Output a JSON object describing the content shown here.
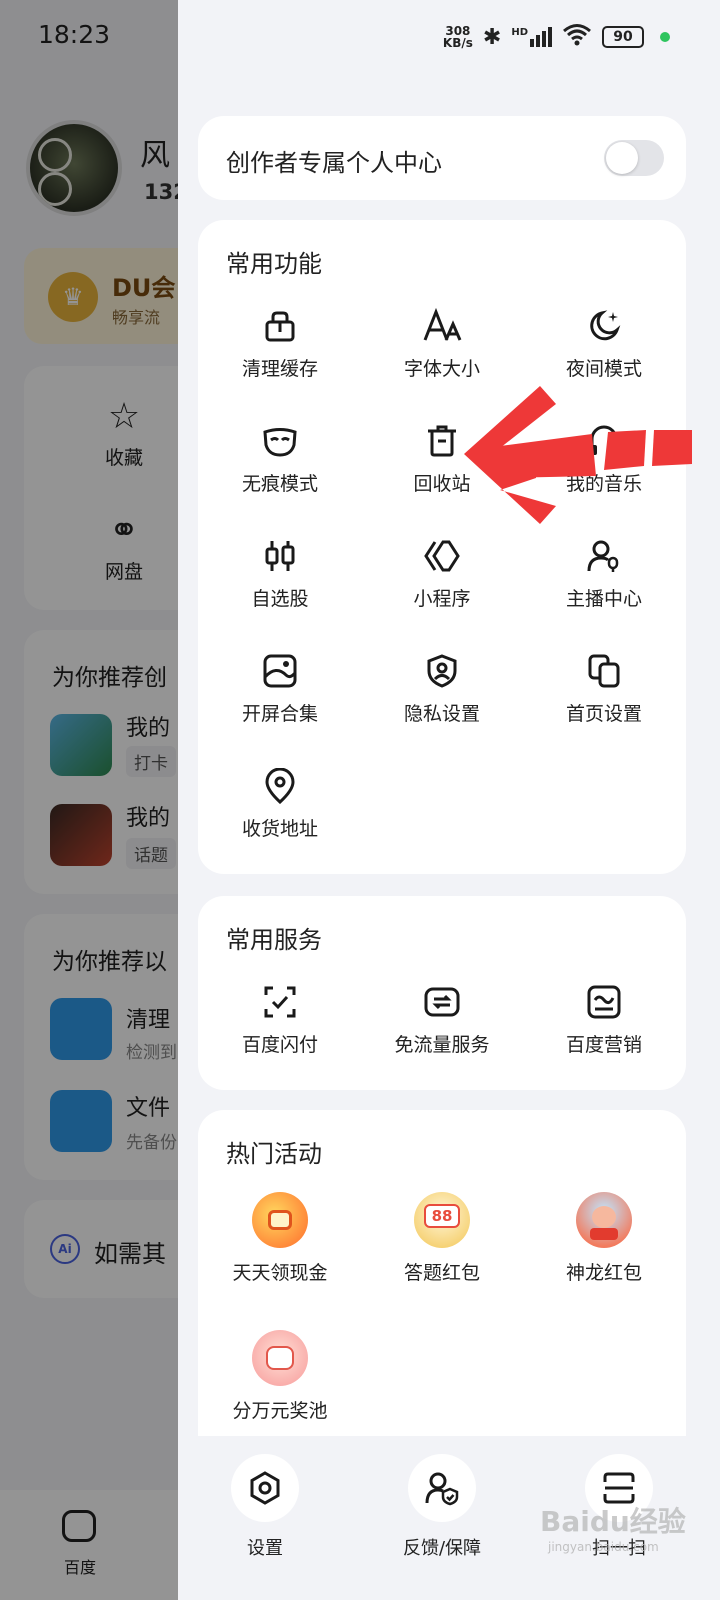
{
  "status_bar": {
    "time": "18:23",
    "net_speed_top": "308",
    "net_speed_bottom": "KB/s",
    "signal_label": "HD",
    "battery": "90"
  },
  "background_page": {
    "username": "风",
    "user_id": "132",
    "vip_title": "DU会",
    "vip_sub": "畅享流",
    "quick_items": [
      {
        "label": "收藏",
        "icon": "star-icon"
      },
      {
        "label": "网盘",
        "icon": "cloud-disk-icon"
      }
    ],
    "recommend_section_1": {
      "title": "为你推荐创",
      "rows": [
        {
          "title": "我的",
          "tag": "打卡"
        },
        {
          "title": "我的",
          "tag": "话题"
        }
      ]
    },
    "recommend_section_2": {
      "title": "为你推荐以",
      "rows": [
        {
          "title": "清理",
          "sub": "检测到"
        },
        {
          "title": "文件",
          "sub": "先备份"
        }
      ]
    },
    "ai_prompt": "如需其",
    "bottom_nav_home": "百度"
  },
  "drawer": {
    "creator_center": {
      "label": "创作者专属个人中心",
      "toggle_on": false
    },
    "common_functions": {
      "title": "常用功能",
      "items": [
        {
          "label": "清理缓存",
          "icon": "clean-cache-icon"
        },
        {
          "label": "字体大小",
          "icon": "font-size-icon"
        },
        {
          "label": "夜间模式",
          "icon": "night-mode-icon"
        },
        {
          "label": "无痕模式",
          "icon": "incognito-mask-icon"
        },
        {
          "label": "回收站",
          "icon": "trash-bin-icon"
        },
        {
          "label": "我的音乐",
          "icon": "music-icon"
        },
        {
          "label": "自选股",
          "icon": "stock-candlestick-icon"
        },
        {
          "label": "小程序",
          "icon": "mini-program-icon"
        },
        {
          "label": "主播中心",
          "icon": "streamer-center-icon"
        },
        {
          "label": "开屏合集",
          "icon": "splash-collection-icon"
        },
        {
          "label": "隐私设置",
          "icon": "privacy-shield-icon"
        },
        {
          "label": "首页设置",
          "icon": "homepage-settings-icon"
        },
        {
          "label": "收货地址",
          "icon": "location-pin-icon"
        }
      ]
    },
    "common_services": {
      "title": "常用服务",
      "items": [
        {
          "label": "百度闪付",
          "icon": "quick-pay-icon"
        },
        {
          "label": "免流量服务",
          "icon": "free-data-icon"
        },
        {
          "label": "百度营销",
          "icon": "marketing-icon"
        }
      ]
    },
    "hot_activities": {
      "title": "热门活动",
      "items": [
        {
          "label": "天天领现金",
          "icon": "daily-cash-icon",
          "color": "#ff7a2e"
        },
        {
          "label": "答题红包",
          "icon": "quiz-red-packet-icon",
          "badge": "88",
          "color": "#f7d36a"
        },
        {
          "label": "神龙红包",
          "icon": "dragon-red-packet-icon",
          "color": "#e85a4a"
        },
        {
          "label": "分万元奖池",
          "icon": "prize-pool-icon",
          "color": "#f59a9a"
        }
      ]
    },
    "bottom_actions": [
      {
        "label": "设置",
        "icon": "settings-hexagon-icon"
      },
      {
        "label": "反馈/保障",
        "icon": "feedback-shield-icon"
      },
      {
        "label": "扫一扫",
        "icon": "scan-icon"
      }
    ],
    "watermark": "Baidu经验",
    "watermark_sub": "jingyan.baidu.com",
    "annotation_arrow_color": "#ee3838"
  }
}
